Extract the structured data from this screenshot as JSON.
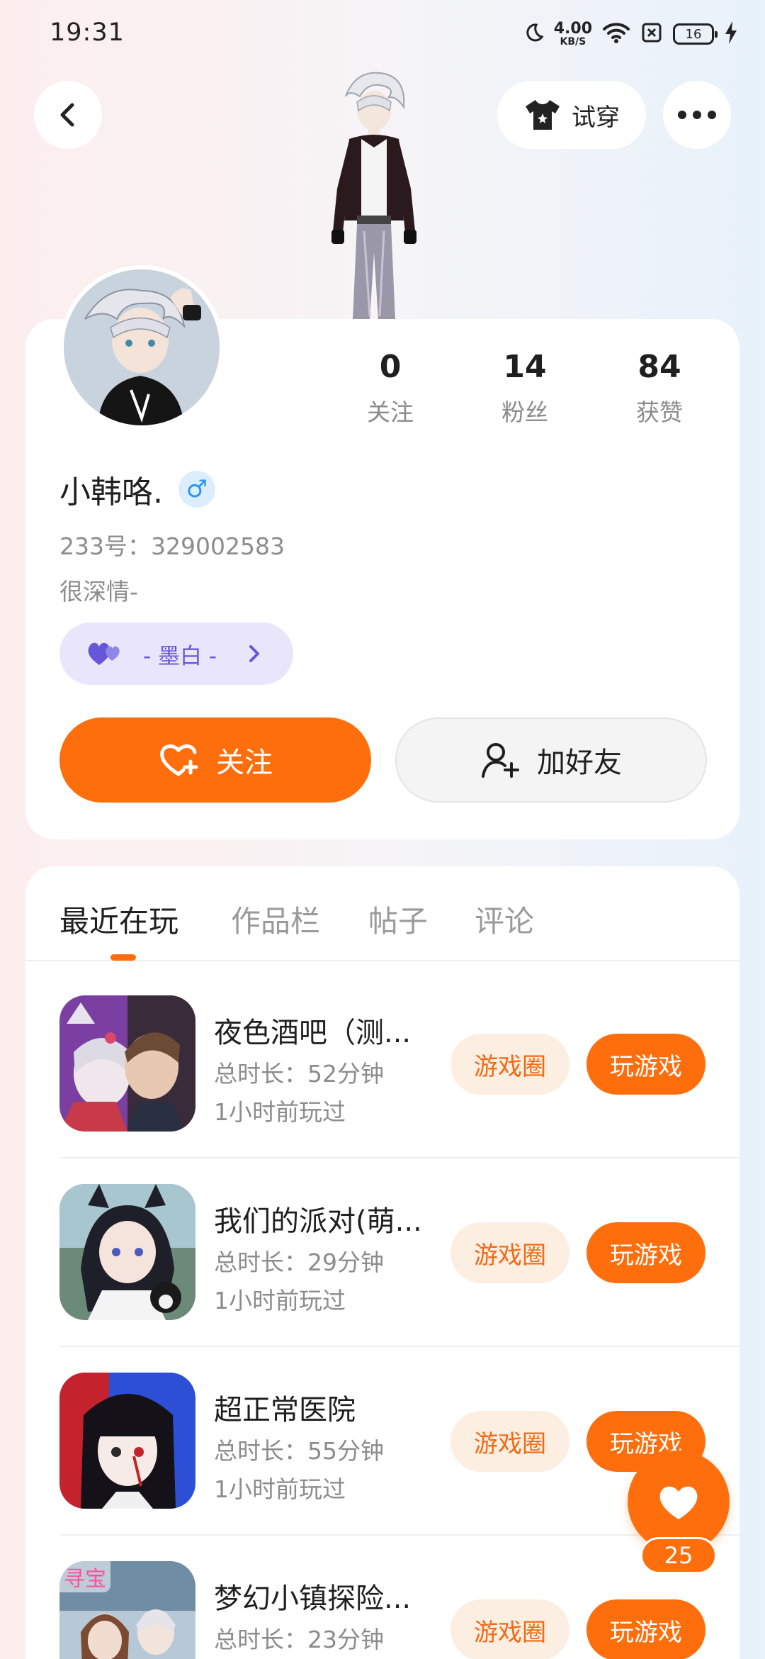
{
  "status_bar": {
    "time": "19:31",
    "net_speed": "4.00",
    "net_unit": "KB/S",
    "battery": "16",
    "icons": [
      "moon-icon",
      "wifi-icon",
      "sim-off-icon",
      "battery-icon",
      "charging-icon"
    ]
  },
  "header": {
    "try_on_label": "试穿"
  },
  "profile": {
    "stats": [
      {
        "value": "0",
        "label": "关注"
      },
      {
        "value": "14",
        "label": "粉丝"
      },
      {
        "value": "84",
        "label": "获赞"
      }
    ],
    "username": "小韩咯.",
    "gender_symbol": "♂",
    "uid": "233号：329002583",
    "bio": "很深情-",
    "tag": "- 墨白 -",
    "follow_label": "关注",
    "add_friend_label": "加好友"
  },
  "tabs": [
    {
      "label": "最近在玩",
      "active": true
    },
    {
      "label": "作品栏",
      "active": false
    },
    {
      "label": "帖子",
      "active": false
    },
    {
      "label": "评论",
      "active": false
    }
  ],
  "games": [
    {
      "title": "夜色酒吧（测...",
      "duration": "总时长：52分钟",
      "last_played": "1小时前玩过",
      "circle_label": "游戏圈",
      "play_label": "玩游戏"
    },
    {
      "title": "我们的派对(萌...",
      "duration": "总时长：29分钟",
      "last_played": "1小时前玩过",
      "circle_label": "游戏圈",
      "play_label": "玩游戏"
    },
    {
      "title": "超正常医院",
      "duration": "总时长：55分钟",
      "last_played": "1小时前玩过",
      "circle_label": "游戏圈",
      "play_label": "玩游戏"
    },
    {
      "title": "梦幻小镇探险...",
      "duration": "总时长：23分钟",
      "last_played": "",
      "circle_label": "游戏圈",
      "play_label": "玩游戏",
      "thumb_badge": "寻宝"
    }
  ],
  "float_like": {
    "count": "25"
  },
  "colors": {
    "accent": "#ff6e0d",
    "tag_bg": "#e9e6fb",
    "tag_text": "#6657d8",
    "gender": "#2f95ea"
  }
}
